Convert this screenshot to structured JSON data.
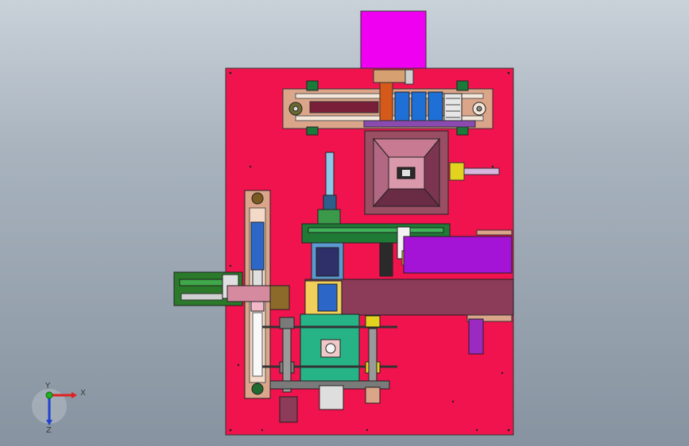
{
  "view": {
    "background_top": "#c9d1d9",
    "background_bottom": "#8793a0"
  },
  "colors": {
    "base_plate": "#f0134e",
    "magenta_block": "#f000f0",
    "conveyor_tan": "#dba58a",
    "green_part": "#2fa84a",
    "teal_plate": "#26b386",
    "purple_part": "#a414d6",
    "maroon_box": "#8c3b58",
    "hopper": "#9a4e64",
    "blue_part": "#2c67c8",
    "yellow_part": "#e2d31e"
  },
  "triad": {
    "x_label": "X",
    "y_label": "Y",
    "z_label": "Z",
    "x_color": "#e02020",
    "y_color": "#20b020",
    "z_color": "#2040d0"
  }
}
